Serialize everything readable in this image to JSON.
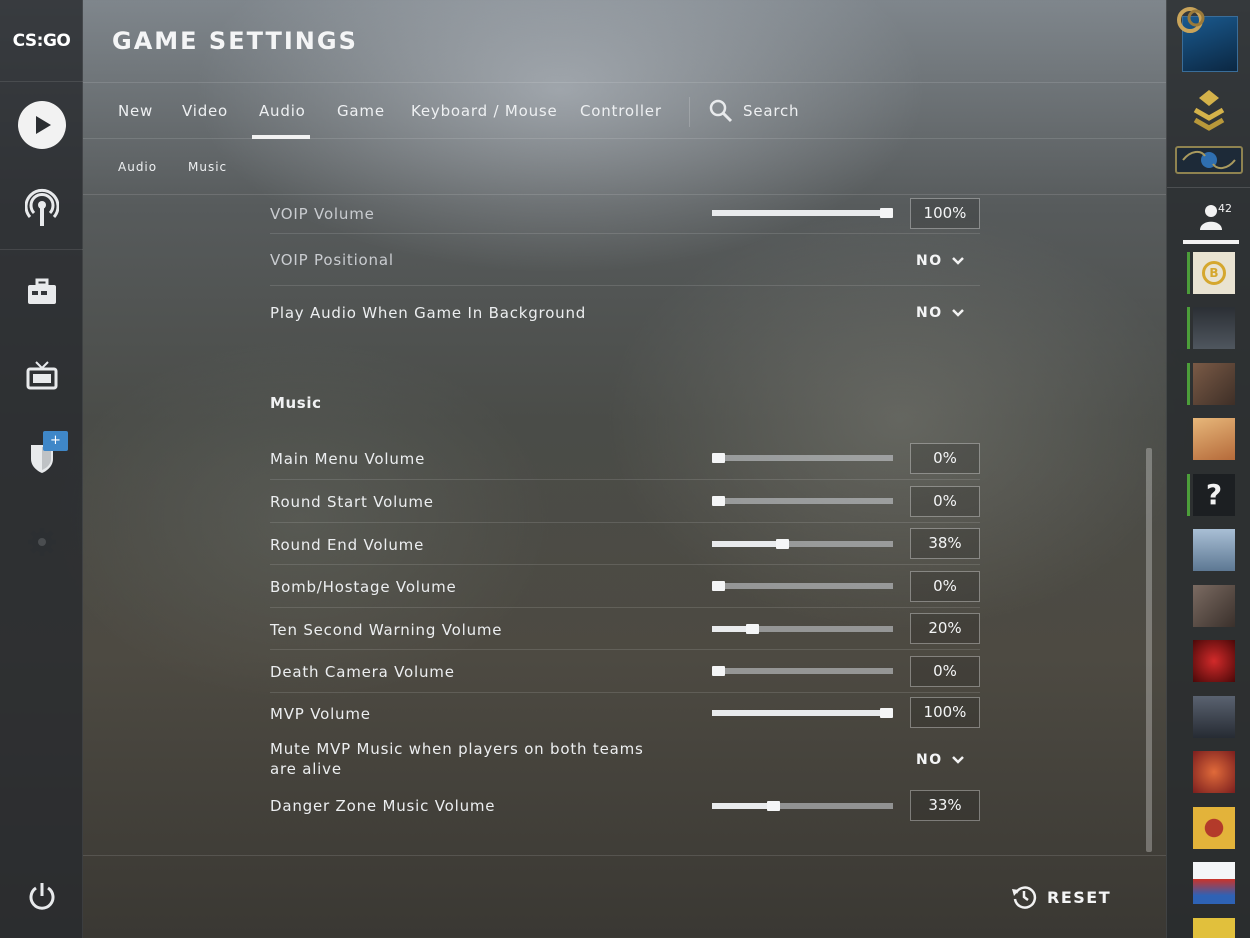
{
  "app": {
    "logo_text": "CS:GO"
  },
  "header": {
    "title": "GAME SETTINGS"
  },
  "tabs": [
    {
      "label": "New"
    },
    {
      "label": "Video"
    },
    {
      "label": "Audio",
      "active": true
    },
    {
      "label": "Game"
    },
    {
      "label": "Keyboard / Mouse"
    },
    {
      "label": "Controller"
    }
  ],
  "search": {
    "label": "Search"
  },
  "subtabs": [
    {
      "label": "Audio"
    },
    {
      "label": "Music"
    }
  ],
  "settings": {
    "voip_volume": {
      "label": "VOIP Volume",
      "value": "100%",
      "level": 1.0
    },
    "voip_positional": {
      "label": "VOIP Positional",
      "value": "NO"
    },
    "play_audio_background": {
      "label": "Play Audio When Game In Background",
      "value": "NO"
    },
    "music_section": {
      "title": "Music"
    },
    "main_menu_volume": {
      "label": "Main Menu Volume",
      "value": "0%",
      "level": 0.0
    },
    "round_start_volume": {
      "label": "Round Start Volume",
      "value": "0%",
      "level": 0.0
    },
    "round_end_volume": {
      "label": "Round End Volume",
      "value": "38%",
      "level": 0.38
    },
    "bomb_hostage_volume": {
      "label": "Bomb/Hostage Volume",
      "value": "0%",
      "level": 0.0
    },
    "ten_second_warning_volume": {
      "label": "Ten Second Warning Volume",
      "value": "20%",
      "level": 0.2
    },
    "death_camera_volume": {
      "label": "Death Camera Volume",
      "value": "0%",
      "level": 0.0
    },
    "mvp_volume": {
      "label": "MVP Volume",
      "value": "100%",
      "level": 1.0
    },
    "mute_mvp_music": {
      "label_line1": "Mute MVP Music when players on both teams",
      "label_line2": "are alive",
      "value": "NO"
    },
    "danger_zone_music_volume": {
      "label": "Danger Zone Music Volume",
      "value": "33%",
      "level": 0.33
    }
  },
  "footer": {
    "reset_label": "RESET"
  },
  "right_panel": {
    "friends_count": "42",
    "badge_text": "B",
    "friend_colors": [
      "#e9e3d2",
      "#3a3f45",
      "#5d4a3e",
      "#d59a63",
      "#1c1f22",
      "#7d98b4",
      "#5a4b44",
      "#8f1616",
      "#3d434b",
      "#b4453a",
      "#d7a128",
      "#dfe3e8",
      "#d9b43c"
    ]
  },
  "colors": {
    "accent": "#f2f2f2",
    "online": "#4c9e3a",
    "badge_blue": "#3f87c8"
  }
}
